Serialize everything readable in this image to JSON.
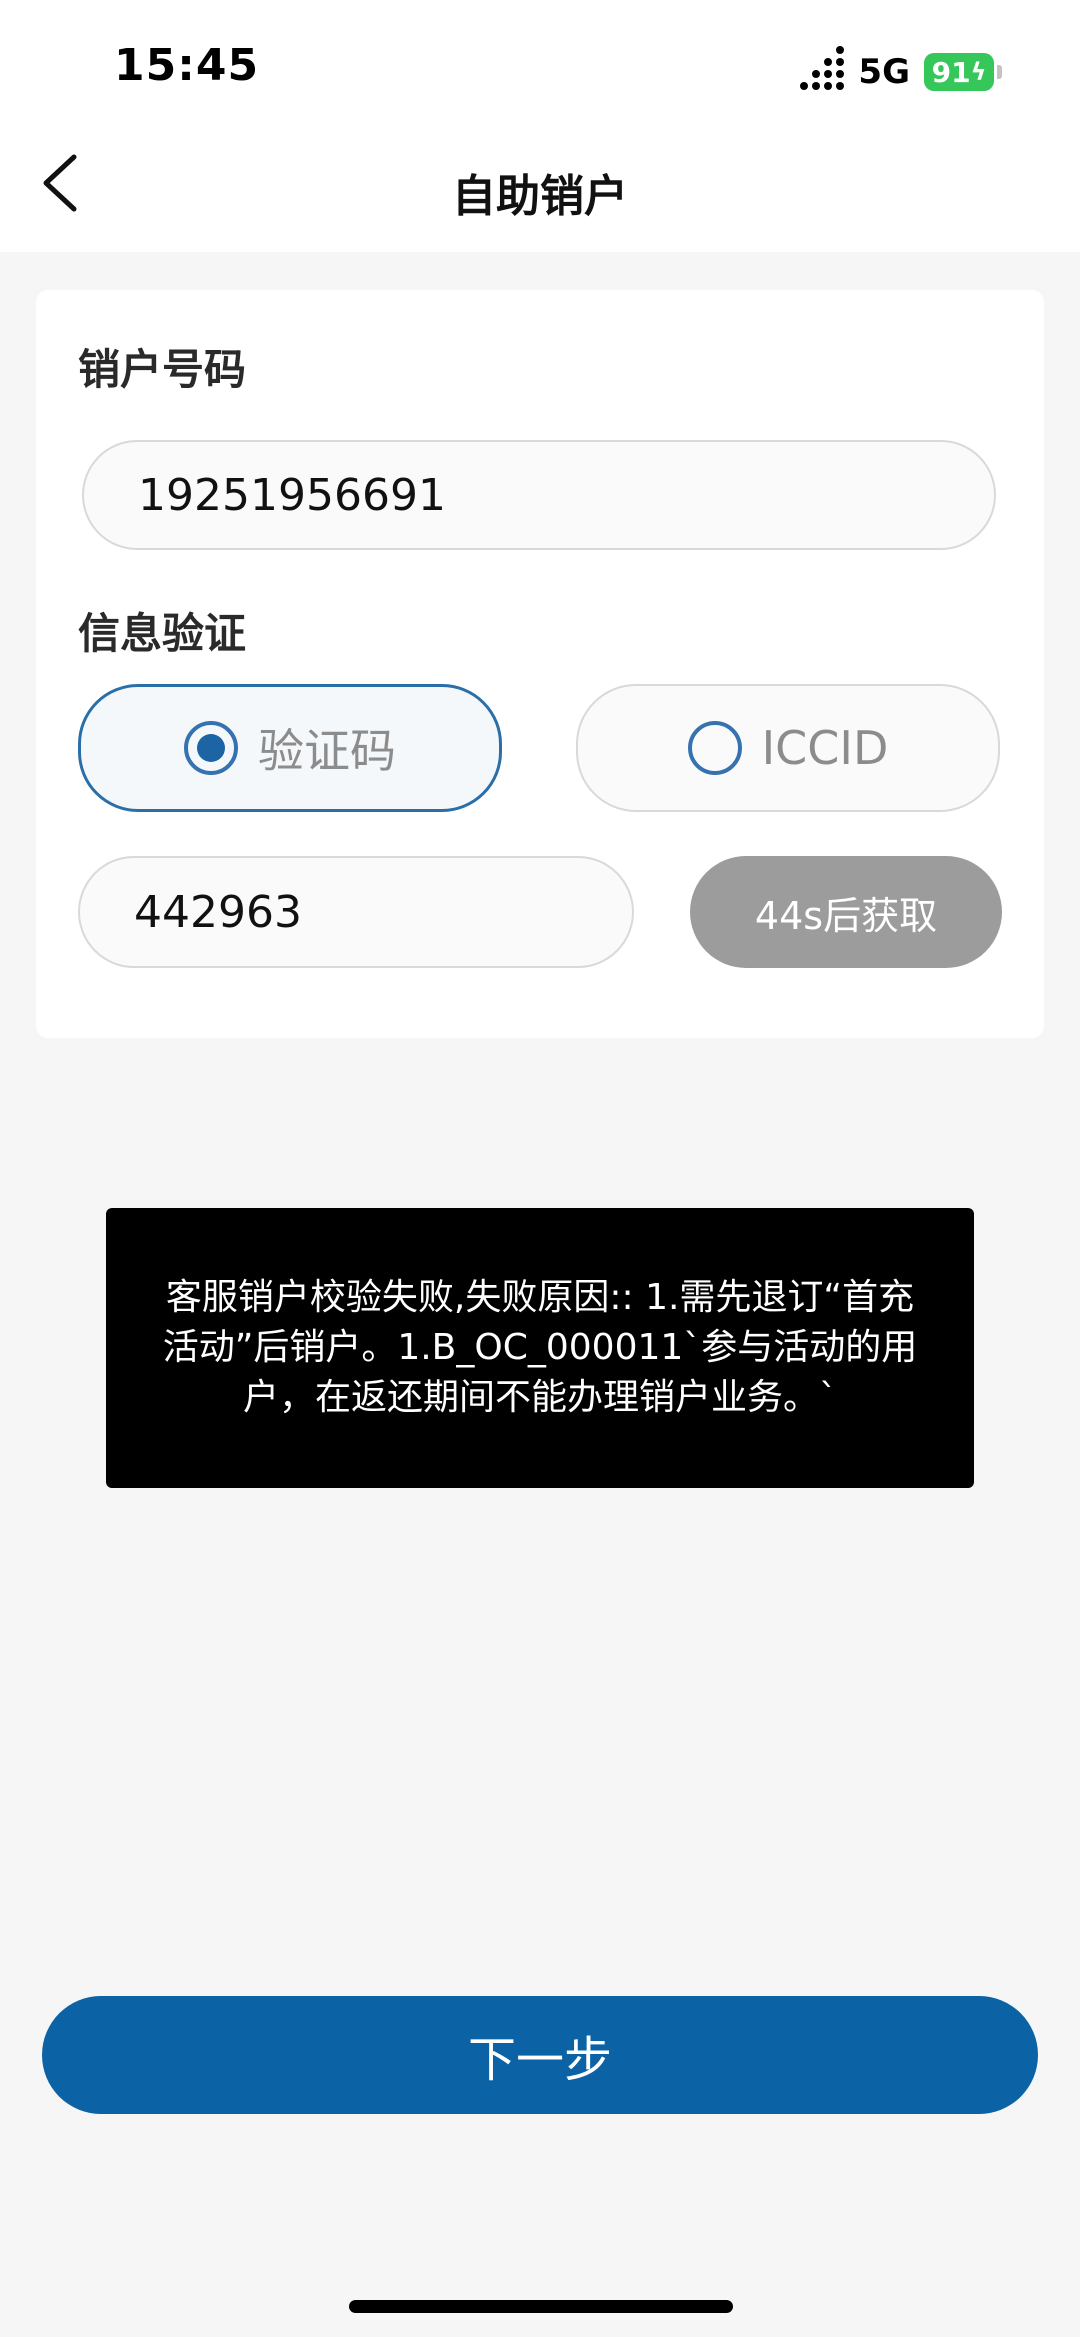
{
  "status_bar": {
    "time": "15:45",
    "network": "5G",
    "battery": "91"
  },
  "header": {
    "title": "自助销户"
  },
  "form": {
    "number_label": "销户号码",
    "number_value": "19251956691",
    "verify_label": "信息验证",
    "options": [
      {
        "label": "验证码",
        "selected": true
      },
      {
        "label": "ICCID",
        "selected": false
      }
    ],
    "code_value": "442963",
    "code_button": "44s后获取"
  },
  "toast": {
    "message": "客服销户校验失败,失败原因:: 1.需先退订“首充活动”后销户。1.B_OC_000011`参与活动的用户，在返还期间不能办理销户业务。`"
  },
  "footer": {
    "next_label": "下一步"
  },
  "colors": {
    "accent": "#0b63a5",
    "battery": "#35c759",
    "disabled_button": "#9c9c9c"
  }
}
